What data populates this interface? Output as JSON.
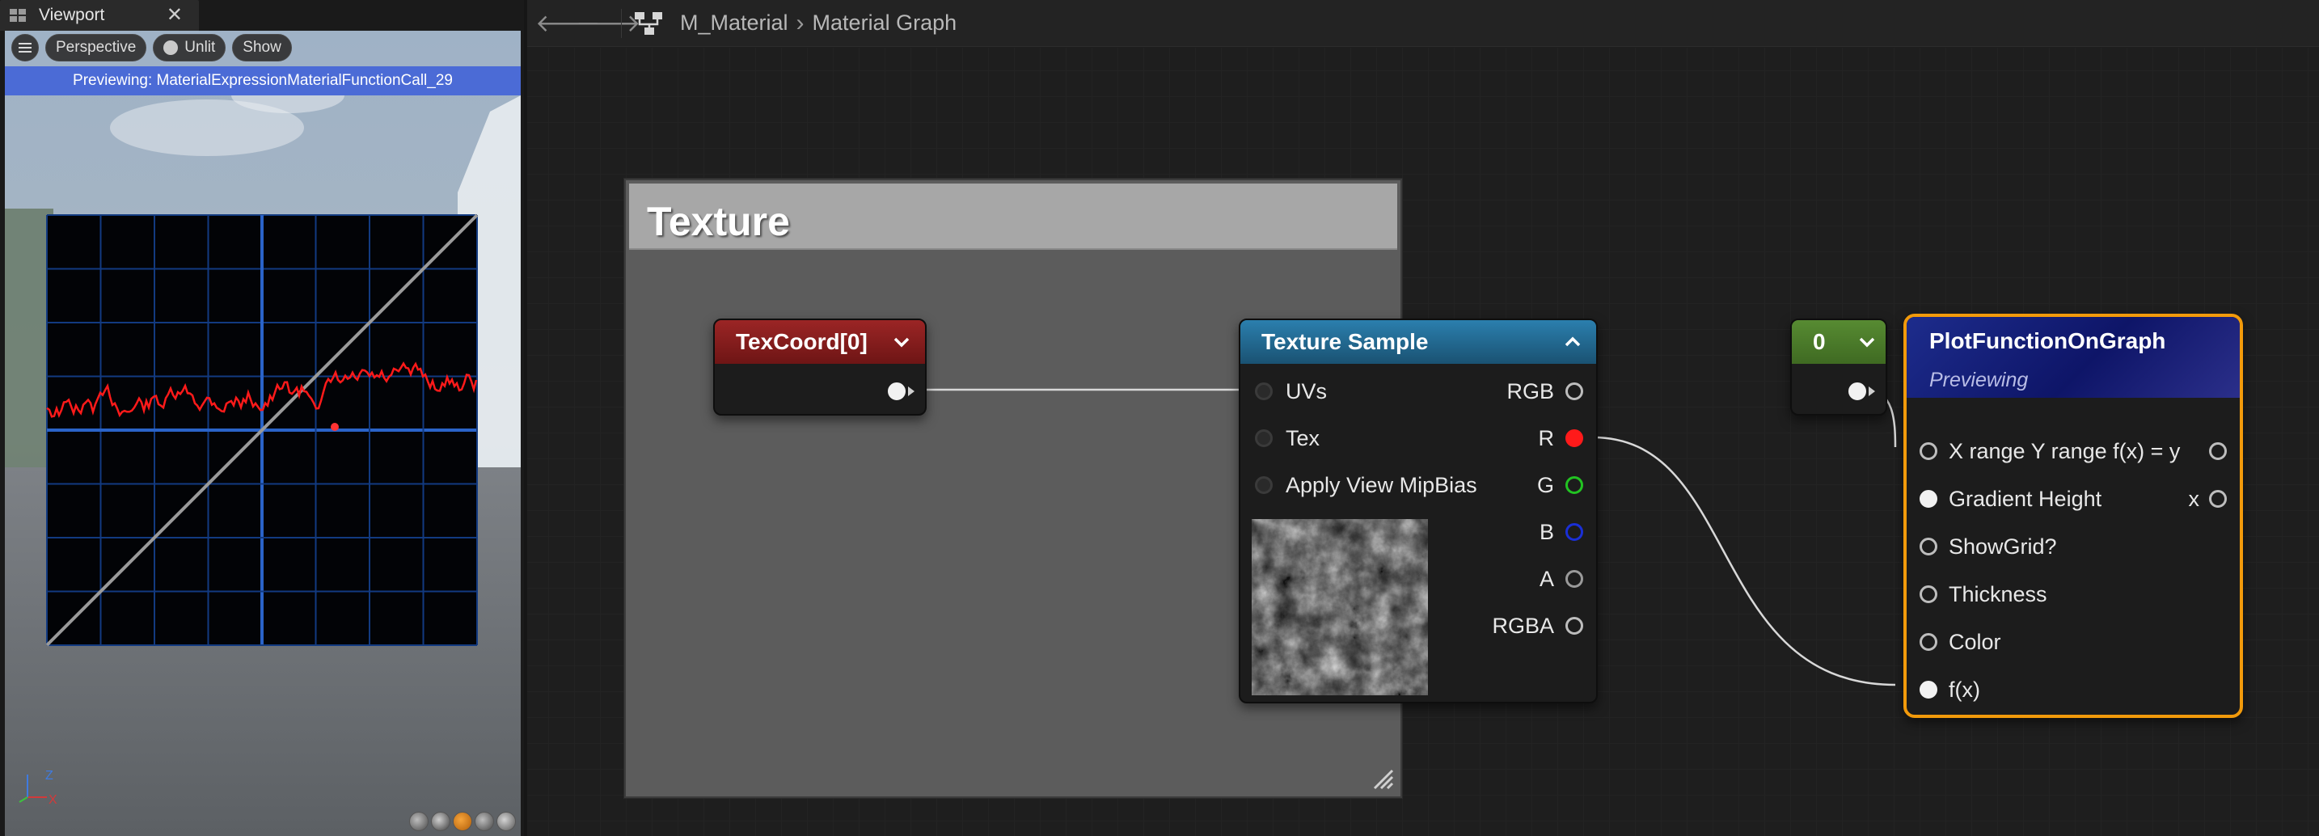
{
  "viewport": {
    "tab_title": "Viewport",
    "tab_icon": "viewport-layout-icon",
    "close_glyph": "✕",
    "toolbar": {
      "menu_icon": "hamburger-menu-icon",
      "perspective_label": "Perspective",
      "lit_label": "Unlit",
      "show_label": "Show"
    },
    "preview_banner": "Previewing: MaterialExpressionMaterialFunctionCall_29",
    "axes": {
      "z": "Z",
      "x": "X"
    },
    "colors": {
      "banner": "#4b6bd6",
      "plot_line": "#ff1a1a",
      "grid": "#1a4fa8"
    }
  },
  "graph": {
    "nav": {
      "back_glyph": "🡐",
      "forward_glyph": "🡒"
    },
    "breadcrumb": {
      "asset": "M_Material",
      "separator": "›",
      "graph": "Material Graph"
    },
    "comment": {
      "title": "Texture"
    },
    "nodes": {
      "texcoord": {
        "title": "TexCoord[0]"
      },
      "texture_sample": {
        "title": "Texture Sample",
        "inputs": [
          "UVs",
          "Tex",
          "Apply View MipBias"
        ],
        "outputs": [
          "RGB",
          "R",
          "G",
          "B",
          "A",
          "RGBA"
        ]
      },
      "constant": {
        "title": "0"
      },
      "plot": {
        "title": "PlotFunctionOnGraph",
        "subtitle": "Previewing",
        "inputs": [
          "X range Y range f(x) = y",
          "Gradient Height",
          "ShowGrid?",
          "Thickness",
          "Color",
          "f(x)"
        ],
        "outputs": [
          "x"
        ]
      }
    },
    "colors": {
      "texcoord_header": "#9b2525",
      "texture_sample_header": "#2b7fae",
      "constant_header": "#578b32",
      "plot_header": "#1d2c8c",
      "selection_outline": "#f29a0b",
      "pin_r": "#ff1a1a",
      "pin_g": "#22c322",
      "pin_b": "#1a2fd6"
    }
  }
}
